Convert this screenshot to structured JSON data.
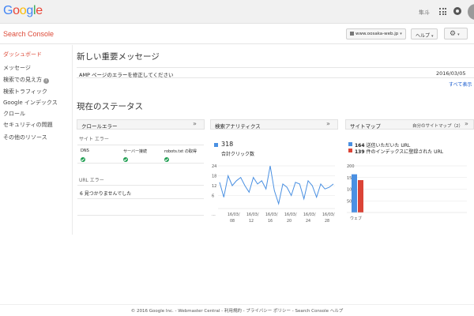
{
  "google_bar": {
    "logo": [
      "G",
      "o",
      "o",
      "g",
      "l",
      "e"
    ],
    "logo_colors": [
      "#4285f4",
      "#ea4335",
      "#fbbc05",
      "#4285f4",
      "#34a853",
      "#ea4335"
    ],
    "user_label": "隼斗"
  },
  "sc_bar": {
    "title": "Search Console",
    "site": "www.oosaka-web.jp",
    "help": "ヘルプ",
    "gear": "⚙"
  },
  "sidebar": {
    "items": [
      {
        "label": "ダッシュボード"
      },
      {
        "label": "メッセージ"
      },
      {
        "label": "検索での見え方"
      },
      {
        "label": "検索トラフィック"
      },
      {
        "label": "Google インデックス"
      },
      {
        "label": "クロール"
      },
      {
        "label": "セキュリティの問題"
      },
      {
        "label": "その他のリソース"
      }
    ]
  },
  "messages": {
    "title": "新しい重要メッセージ",
    "item_text": "AMP ページのエラーを修正してください",
    "item_date": "2016/03/05",
    "show_all": "すべて表示"
  },
  "status": {
    "title": "現在のステータス",
    "chev": "»",
    "crawl": {
      "title": "クロールエラー",
      "site_errors": "サイト エラー",
      "columns": [
        "DNS",
        "サーバー接続",
        "robots.txt の取得"
      ],
      "url_errors": "URL エラー",
      "url_result": "6 見つかりませんでした"
    },
    "analytics": {
      "title": "検索アナリティクス",
      "count": "318",
      "count_label": "合計クリック数",
      "series_color": "#4a90e2"
    },
    "sitemap": {
      "title": "サイトマップ",
      "my_sitemaps": "自分のサイトマップ（2）",
      "submitted_count": "164",
      "submitted_label": "送信いただいた URL",
      "indexed_count": "139",
      "indexed_label": "件のインデックスに登録された URL",
      "submitted_color": "#4a90e2",
      "indexed_color": "#db4437"
    }
  },
  "chart_data": [
    {
      "type": "line",
      "title": "",
      "yticks": [
        "24",
        "18",
        "12",
        "6"
      ],
      "ylim": [
        0,
        24
      ],
      "xtick_top": [
        "…",
        "16/03/",
        "16/03/",
        "16/03/",
        "16/03/",
        "16/03/",
        "16/03/"
      ],
      "xtick_bottom": [
        "",
        "08",
        "12",
        "16",
        "20",
        "24",
        "28"
      ],
      "series": [
        {
          "values": [
            14,
            5,
            18,
            12,
            15,
            17,
            12,
            8,
            17,
            13,
            15,
            10,
            24,
            9,
            1,
            13,
            11,
            6,
            14,
            13,
            4,
            15,
            12,
            5,
            13,
            10,
            11,
            13
          ]
        }
      ]
    },
    {
      "type": "bar",
      "title": "",
      "categories": [
        "ウェブ"
      ],
      "yticks": [
        "200",
        "150",
        "100",
        "50"
      ],
      "ylim": [
        0,
        200
      ],
      "series": [
        {
          "name": "送信いただいた URL",
          "values": [
            164
          ]
        },
        {
          "name": "件のインデックスに登録された URL",
          "values": [
            139
          ]
        }
      ]
    }
  ],
  "footer": {
    "text": "© 2016 Google Inc. - Webmaster Central - 利用規約 - プライバシー ポリシー - Search Console ヘルプ"
  }
}
